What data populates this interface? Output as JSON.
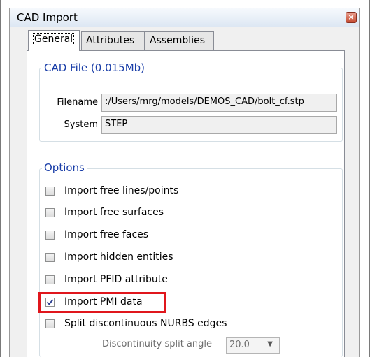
{
  "window": {
    "title": "CAD Import",
    "close_glyph": "×"
  },
  "tabs": [
    {
      "label": "General",
      "active": true
    },
    {
      "label": "Attributes",
      "active": false
    },
    {
      "label": "Assemblies",
      "active": false
    }
  ],
  "cad_file": {
    "group_title": "CAD File (0.015Mb)",
    "filename_label": "Filename",
    "filename_value": ":/Users/mrg/models/DEMOS_CAD/bolt_cf.stp",
    "system_label": "System",
    "system_value": "STEP"
  },
  "options": {
    "group_title": "Options",
    "checkboxes": [
      {
        "label": "Import free lines/points",
        "checked": false
      },
      {
        "label": "Import free surfaces",
        "checked": false
      },
      {
        "label": "Import free faces",
        "checked": false
      },
      {
        "label": "Import hidden entities",
        "checked": false
      },
      {
        "label": "Import PFID attribute",
        "checked": false
      },
      {
        "label": "Import PMI data",
        "checked": true
      },
      {
        "label": "Split discontinuous NURBS edges",
        "checked": false
      }
    ],
    "split_angle_label": "Discontinuity split angle",
    "split_angle_value": "20.0"
  },
  "icons": {
    "close": "close-icon",
    "dropdown": "chevron-down-icon",
    "check": "check-icon"
  },
  "colors": {
    "group_title": "#1a3ea8",
    "highlight": "#e0161c",
    "close_button": "#c44a30"
  }
}
